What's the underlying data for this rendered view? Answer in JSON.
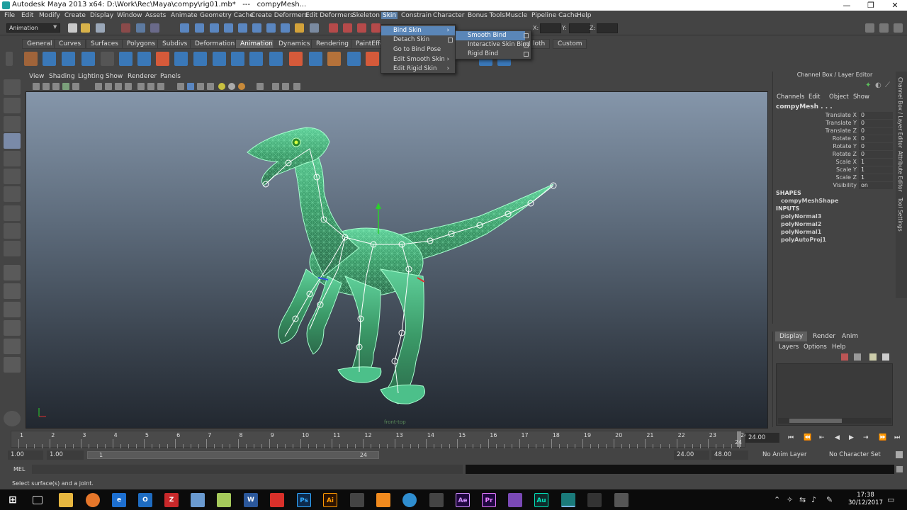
{
  "window": {
    "title": "Autodesk Maya 2013 x64: D:\\Work\\Rec\\Maya\\compy\\rig01.mb*   ---   compyMesh...",
    "minimize": "—",
    "maximize": "❐",
    "close": "✕"
  },
  "menubar": [
    "File",
    "Edit",
    "Modify",
    "Create",
    "Display",
    "Window",
    "Assets",
    "Animate",
    "Geometry Cache",
    "Create Deformers",
    "Edit Deformers",
    "Skeleton",
    "Skin",
    "Constrain",
    "Character",
    "Bonus Tools",
    "Muscle",
    "Pipeline Cache",
    "Help"
  ],
  "status_line": {
    "mode": "Animation",
    "x_label": "X:",
    "y_label": "Y:",
    "z_label": "Z:"
  },
  "shelf_tabs": [
    "General",
    "Curves",
    "Surfaces",
    "Polygons",
    "Subdivs",
    "Deformation",
    "Animation",
    "Dynamics",
    "Rendering",
    "PaintEffe",
    "loth",
    "Custom"
  ],
  "shelf_active": "Animation",
  "skin_menu": {
    "items": [
      {
        "label": "Bind Skin",
        "submenu": true
      },
      {
        "label": "Detach Skin",
        "option": true
      },
      {
        "label": "Go to Bind Pose"
      },
      {
        "label": "Edit Smooth Skin",
        "submenu": true
      },
      {
        "label": "Edit Rigid Skin",
        "submenu": true
      }
    ],
    "bind_skin_submenu": [
      {
        "label": "Smooth Bind",
        "option": true
      },
      {
        "label": "Interactive Skin Bind",
        "option": true
      },
      {
        "label": "Rigid Bind",
        "option": true
      }
    ]
  },
  "viewport": {
    "menu": [
      "View",
      "Shading",
      "Lighting",
      "Show",
      "Renderer",
      "Panels"
    ],
    "hud": "front-top"
  },
  "channel_box": {
    "title": "Channel Box / Layer Editor",
    "menu": [
      "Channels",
      "Edit",
      "Object",
      "Show"
    ],
    "object": "compyMesh . . .",
    "attributes": [
      {
        "name": "Translate X",
        "value": "0"
      },
      {
        "name": "Translate Y",
        "value": "0"
      },
      {
        "name": "Translate Z",
        "value": "0"
      },
      {
        "name": "Rotate X",
        "value": "0"
      },
      {
        "name": "Rotate Y",
        "value": "0"
      },
      {
        "name": "Rotate Z",
        "value": "0"
      },
      {
        "name": "Scale X",
        "value": "1"
      },
      {
        "name": "Scale Y",
        "value": "1"
      },
      {
        "name": "Scale Z",
        "value": "1"
      },
      {
        "name": "Visibility",
        "value": "on"
      }
    ],
    "shapes_label": "SHAPES",
    "shapes": [
      "compyMeshShape"
    ],
    "inputs_label": "INPUTS",
    "inputs": [
      "polyNormal3",
      "polyNormal2",
      "polyNormal1",
      "polyAutoProj1"
    ]
  },
  "side_tabs": [
    "Channel Box / Layer Editor",
    "Attribute Editor",
    "Tool Settings"
  ],
  "layer_editor": {
    "tabs": [
      "Display",
      "Render",
      "Anim"
    ],
    "menu": [
      "Layers",
      "Options",
      "Help"
    ]
  },
  "timeline": {
    "ticks": [
      "1",
      "2",
      "3",
      "4",
      "5",
      "6",
      "7",
      "8",
      "9",
      "10",
      "11",
      "12",
      "13",
      "14",
      "15",
      "16",
      "17",
      "18",
      "19",
      "20",
      "21",
      "22",
      "23",
      "24"
    ],
    "current_frame": "24.00",
    "end_marker": "24"
  },
  "range": {
    "start": "1.00",
    "anim_start": "1.00",
    "slider_start": "1",
    "slider_end": "24",
    "end": "24.00",
    "anim_end": "48.00",
    "anim_layer": "No Anim Layer",
    "character_set": "No Character Set"
  },
  "command_line": {
    "label": "MEL"
  },
  "help_line": "Select surface(s) and a joint.",
  "taskbar": {
    "time": "17:38",
    "date": "30/12/2017",
    "apps": [
      "Ps",
      "Ai",
      "Ae",
      "Pr",
      "Au"
    ]
  }
}
